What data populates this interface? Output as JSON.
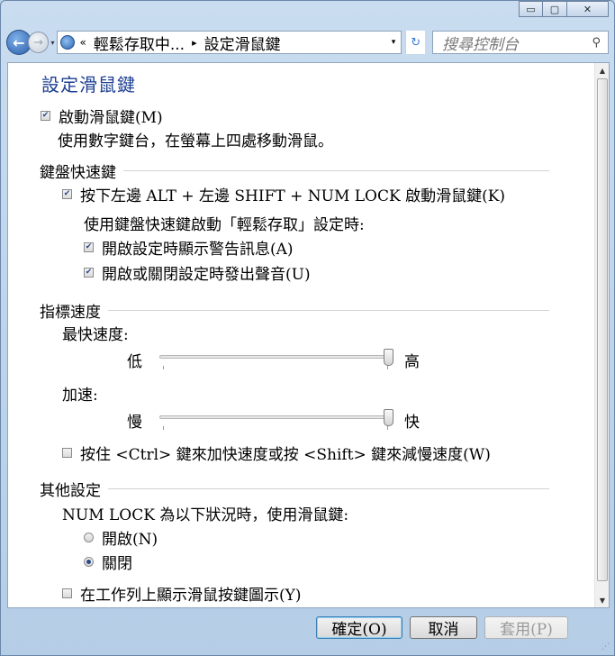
{
  "window": {
    "minimize_glyph": "▭",
    "maximize_glyph": "▢",
    "close_glyph": "✕"
  },
  "navbar": {
    "back_glyph": "←",
    "forward_glyph": "→",
    "history_glyph": "▾",
    "breadcrumb_overflow": "«",
    "breadcrumb_parent": "輕鬆存取中...",
    "breadcrumb_separator": "▸",
    "breadcrumb_current": "設定滑鼠鍵",
    "address_drop_glyph": "▾",
    "refresh_glyph": "↻",
    "search_placeholder": "搜尋控制台",
    "search_glyph": "⚲"
  },
  "page": {
    "title": "設定滑鼠鍵",
    "enable_mousekeys": {
      "label": "啟動滑鼠鍵(M)",
      "checked": true
    },
    "enable_desc": "使用數字鍵台，在螢幕上四處移動滑鼠。",
    "shortcut_group": "鍵盤快速鍵",
    "shortcut_toggle": {
      "label": "按下左邊 ALT + 左邊 SHIFT + NUM LOCK 啟動滑鼠鍵(K)",
      "checked": true
    },
    "shortcut_sub_heading": "使用鍵盤快速鍵啟動「輕鬆存取」設定時:",
    "show_warning": {
      "label": "開啟設定時顯示警告訊息(A)",
      "checked": true
    },
    "play_sound": {
      "label": "開啟或關閉設定時發出聲音(U)",
      "checked": true
    },
    "pointer_group": "指標速度",
    "top_speed_label": "最快速度:",
    "top_speed_low": "低",
    "top_speed_high": "高",
    "top_speed_level": 0.98,
    "accel_label": "加速:",
    "accel_slow": "慢",
    "accel_fast": "快",
    "accel_level": 0.98,
    "ctrl_shift": {
      "label": "按住 <Ctrl> 鍵來加快速度或按 <Shift> 鍵來減慢速度(W)",
      "checked": false
    },
    "other_group": "其他設定",
    "numlock_heading": "NUM LOCK 為以下狀況時，使用滑鼠鍵:",
    "radio_on": {
      "label": "開啟(N)",
      "selected": false
    },
    "radio_off": {
      "label": "關閉",
      "selected": true
    },
    "taskbar_icon": {
      "label": "在工作列上顯示滑鼠按鍵圖示(Y)",
      "checked": false
    }
  },
  "scrollbar": {
    "up_glyph": "▲",
    "down_glyph": "▼"
  },
  "buttons": {
    "ok": "確定(O)",
    "cancel": "取消",
    "apply": "套用(P)"
  },
  "colors": {
    "title": "#1e3f92",
    "frame": "#c9dcf0",
    "check": "#2a4a8a"
  }
}
